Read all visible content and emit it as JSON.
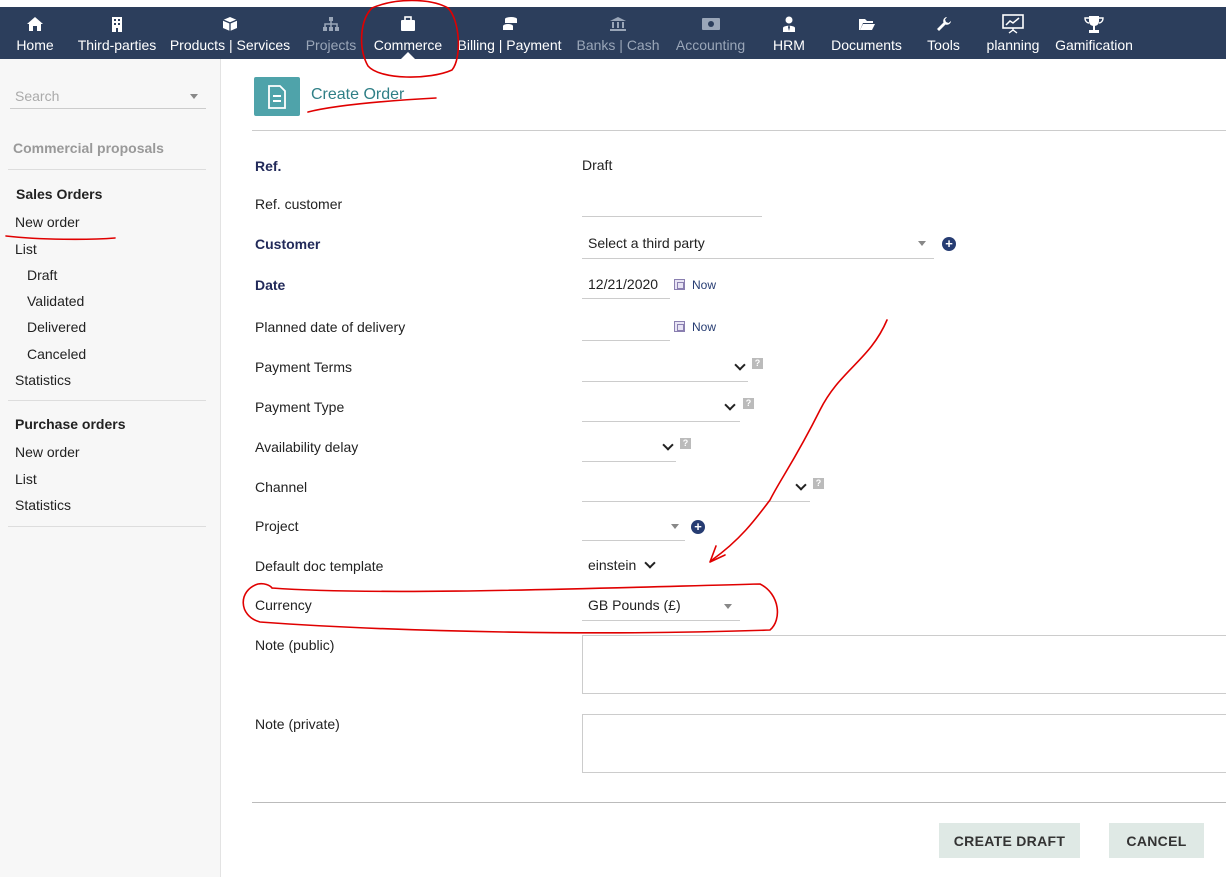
{
  "topnav": {
    "items": [
      {
        "label": "Home",
        "icon": "home-icon",
        "dim": false
      },
      {
        "label": "Third-parties",
        "icon": "building-icon",
        "dim": false
      },
      {
        "label": "Products | Services",
        "icon": "cube-icon",
        "dim": false
      },
      {
        "label": "Projects",
        "icon": "sitemap-icon",
        "dim": true
      },
      {
        "label": "Commerce",
        "icon": "briefcase-icon",
        "dim": false,
        "active": true
      },
      {
        "label": "Billing | Payment",
        "icon": "coins-icon",
        "dim": false
      },
      {
        "label": "Banks | Cash",
        "icon": "bank-icon",
        "dim": true
      },
      {
        "label": "Accounting",
        "icon": "money-bill-icon",
        "dim": true
      },
      {
        "label": "HRM",
        "icon": "user-tie-icon",
        "dim": false
      },
      {
        "label": "Documents",
        "icon": "folder-open-icon",
        "dim": false
      },
      {
        "label": "Tools",
        "icon": "wrench-icon",
        "dim": false
      },
      {
        "label": "planning",
        "icon": "presentation-chart-icon",
        "dim": false
      },
      {
        "label": "Gamification",
        "icon": "trophy-icon",
        "dim": false
      }
    ]
  },
  "sidebar": {
    "search_placeholder": "Search",
    "commercial_proposals": "Commercial proposals",
    "sales_orders": {
      "heading": "Sales Orders",
      "new_order": "New order",
      "list": "List",
      "draft": "Draft",
      "validated": "Validated",
      "delivered": "Delivered",
      "canceled": "Canceled",
      "statistics": "Statistics"
    },
    "purchase_orders": {
      "heading": "Purchase orders",
      "new_order": "New order",
      "list": "List",
      "statistics": "Statistics"
    }
  },
  "page": {
    "title": "Create Order"
  },
  "form": {
    "ref_label": "Ref.",
    "ref_value": "Draft",
    "ref_customer_label": "Ref. customer",
    "customer_label": "Customer",
    "customer_placeholder": "Select a third party",
    "date_label": "Date",
    "date_value": "12/21/2020",
    "now_label": "Now",
    "planned_delivery_label": "Planned date of delivery",
    "payment_terms_label": "Payment Terms",
    "payment_type_label": "Payment Type",
    "availability_delay_label": "Availability delay",
    "channel_label": "Channel",
    "project_label": "Project",
    "default_doc_template_label": "Default doc template",
    "default_doc_template_value": "einstein",
    "currency_label": "Currency",
    "currency_value": "GB Pounds (£)",
    "note_public_label": "Note (public)",
    "note_private_label": "Note (private)",
    "help_glyph": "?"
  },
  "buttons": {
    "create_draft": "CREATE DRAFT",
    "cancel": "CANCEL"
  },
  "colors": {
    "topbar": "#2c3e5c",
    "accent": "#4fa3aa",
    "annotation": "#e00000"
  }
}
